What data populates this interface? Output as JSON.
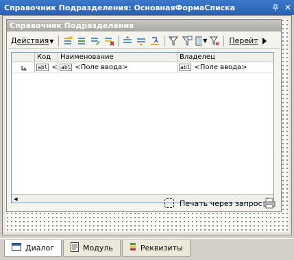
{
  "window": {
    "title": "Справочник Подразделения: ОсновнаяФормаСписка"
  },
  "form": {
    "title": "Справочник Подразделения"
  },
  "toolbar": {
    "actions_label": "Действия",
    "goto_label": "Перейт"
  },
  "grid": {
    "columns": [
      "Код",
      "Наименование",
      "Владелец"
    ],
    "row": {
      "code": "<...",
      "name": "<Поле ввода>",
      "owner": "<Поле ввода>"
    },
    "field_chip": "abl"
  },
  "print": {
    "label": "Печать через запрос"
  },
  "tabs": [
    {
      "label": "Диалог"
    },
    {
      "label": "Модуль"
    },
    {
      "label": "Реквизиты"
    }
  ]
}
